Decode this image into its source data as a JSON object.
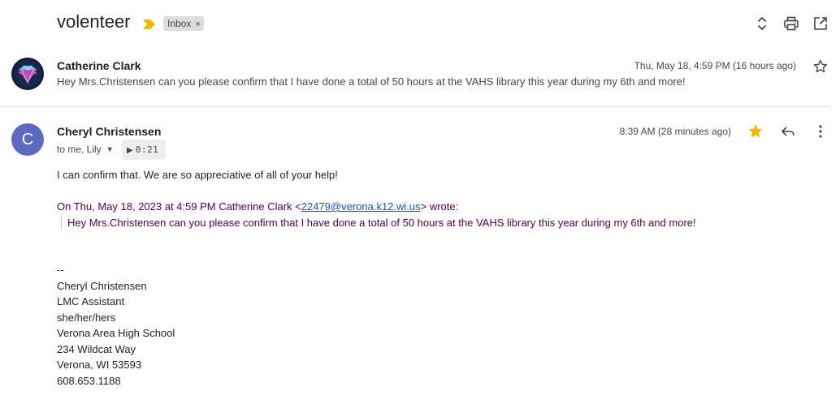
{
  "thread": {
    "subject": "volenteer",
    "label": "Inbox",
    "label_close": "×"
  },
  "header_icons": [
    "expand-collapse-icon",
    "print-icon",
    "open-in-new-window-icon"
  ],
  "messages": [
    {
      "sender": "Catherine Clark",
      "date": "Thu, May 18, 4:59 PM (16 hours ago)",
      "snippet": "Hey Mrs.Christensen can you please confirm that I have done a total of 50 hours at the VAHS library this year during my 6th and more!",
      "starred": false
    },
    {
      "sender": "Cheryl Christensen",
      "avatar_letter": "C",
      "recipients": "to me, Lily",
      "audio_duration": "0:21",
      "date": "8:39 AM (28 minutes ago)",
      "starred": true,
      "body": "I can confirm that.  We are so appreciative of all of your help!",
      "quote": {
        "header_prefix": "On Thu, May 18, 2023 at 4:59 PM Catherine Clark <",
        "email": "22479@verona.k12.wi.us",
        "header_suffix": "> wrote:",
        "text": "Hey Mrs.Christensen can you please confirm that I have done a total of 50 hours at the VAHS library this year during my 6th and more!"
      },
      "signature": [
        "--",
        "Cheryl Christensen",
        "LMC Assistant",
        "she/her/hers",
        "Verona Area High School",
        "234 Wildcat Way",
        "Verona, WI 53593",
        "608.653.1188"
      ]
    }
  ],
  "colors": {
    "avatar_c": "#5c6bc0",
    "star_on": "#f4b400",
    "importance_marker": "#f4b400",
    "quote_text": "#500050",
    "link": "#1155cc"
  }
}
